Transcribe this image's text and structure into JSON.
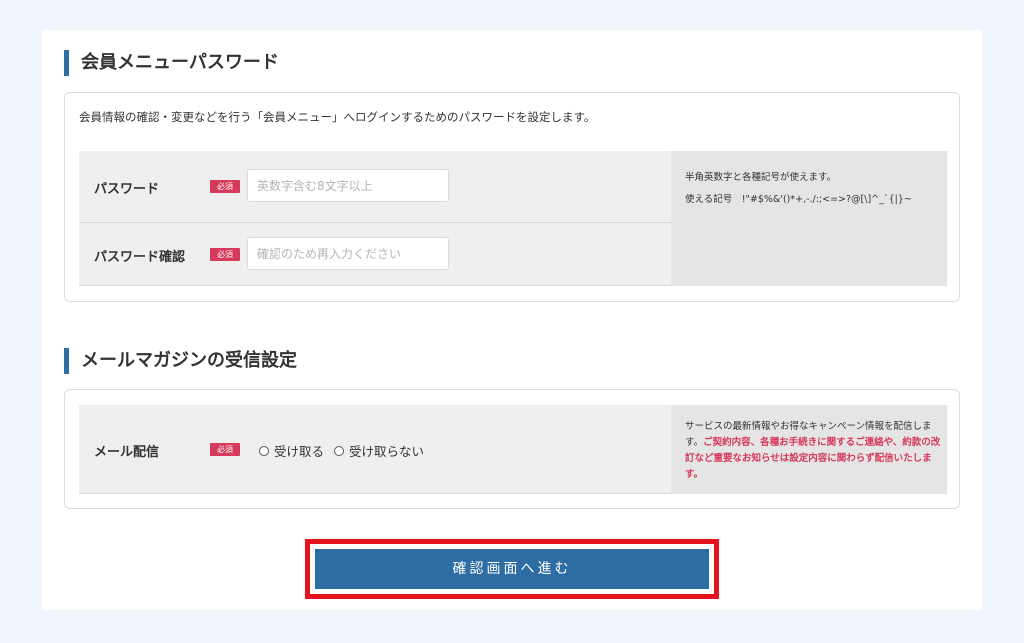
{
  "password_section": {
    "title": "会員メニューパスワード",
    "intro": "会員情報の確認・変更などを行う「会員メニュー」へログインするためのパスワードを設定します。",
    "password": {
      "label": "パスワード",
      "required": "必須",
      "placeholder": "英数字含む8文字以上"
    },
    "password_confirm": {
      "label": "パスワード確認",
      "required": "必須",
      "placeholder": "確認のため再入力ください"
    },
    "help_line1": "半角英数字と各種記号が使えます。",
    "help_line2": "使える記号　!\"#$%&'()*+,-./:;<=>?@[\\]^_`{|}~"
  },
  "mail_section": {
    "title": "メールマガジンの受信設定",
    "label": "メール配信",
    "required": "必須",
    "options": [
      "受け取る",
      "受け取らない"
    ],
    "help_normal": "サービスの最新情報やお得なキャンペーン情報を配信します。",
    "help_red": "ご契約内容、各種お手続きに関するご連絡や、約款の改訂など重要なお知らせは設定内容に関わらず配信いたします。"
  },
  "submit": {
    "label": "確認画面へ進む"
  },
  "colors": {
    "accent": "#2d6da3",
    "required": "#d63a5b",
    "highlight": "#e4131c",
    "page_bg": "#f1f5fc"
  }
}
